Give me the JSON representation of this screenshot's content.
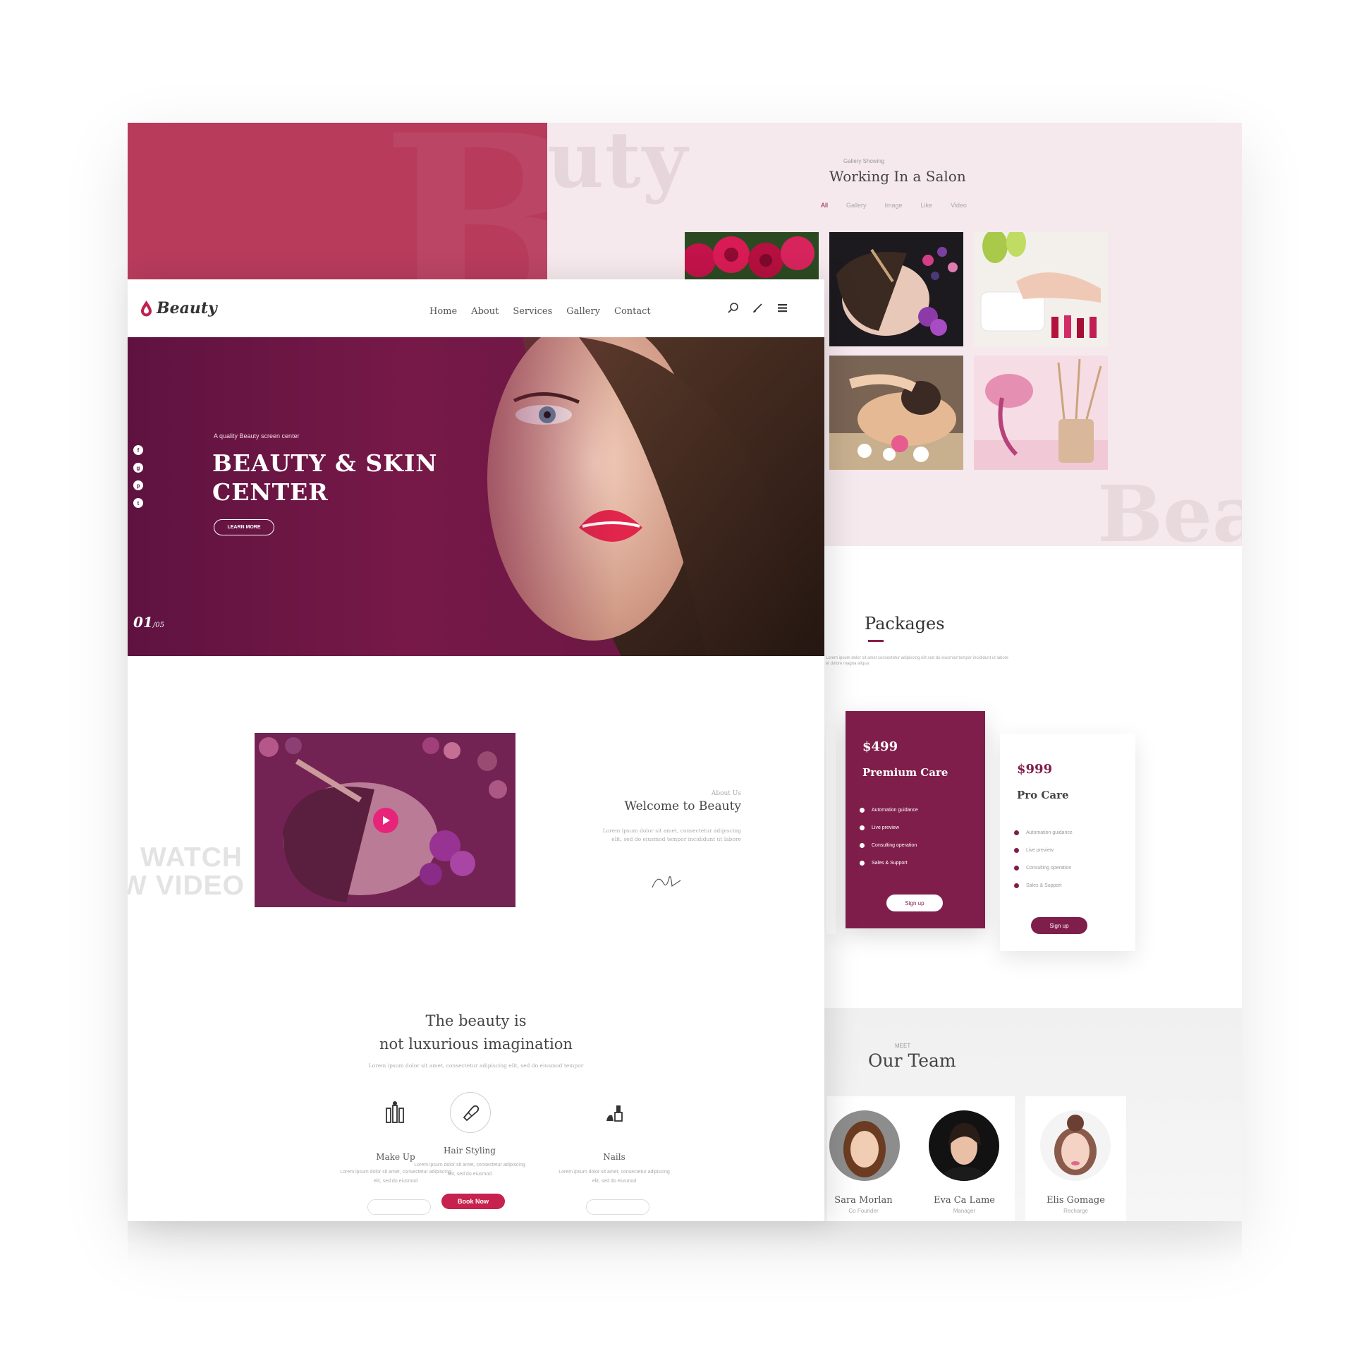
{
  "brand": {
    "name": "Beauty",
    "accent": "#801e4b",
    "crimson": "#b83b5c",
    "pink": "#e8237a"
  },
  "nav": {
    "items": [
      "Home",
      "About",
      "Services",
      "Gallery",
      "Contact"
    ],
    "icons": [
      "search-icon",
      "brush-icon",
      "menu-icon"
    ]
  },
  "hero": {
    "kicker": "A quality Beauty screen center",
    "title": "BEAUTY & SKIN CENTER",
    "button": "LEARN MORE",
    "counter_current": "01",
    "counter_total": "/05",
    "socials": [
      "f",
      "g",
      "p",
      "t"
    ]
  },
  "video": {
    "watch_line1": "WATCH",
    "watch_line2": "W VIDEO"
  },
  "about": {
    "kicker": "About Us",
    "title": "Welcome to Beauty",
    "text": "Lorem ipsum dolor sit amet, consectetur adipiscing elit, sed do eiusmod tempor incididunt ut labore"
  },
  "quote": {
    "line1": "The beauty is",
    "line2": "not luxurious imagination",
    "sub": "Lorem ipsum dolor sit amet, consectetur adipiscing elit, sed do eiusmod tempor"
  },
  "services": [
    {
      "name": "Make Up",
      "desc": "Lorem ipsum dolor sit amet, consectetur adipiscing elit, sed do eiusmod",
      "icon": "makeup-icon"
    },
    {
      "name": "Hair Styling",
      "desc": "Lorem ipsum dolor sit amet, consectetur adipiscing elit, sed do eiusmod",
      "icon": "hair-dryer-icon",
      "button": "Book Now"
    },
    {
      "name": "Nails",
      "desc": "Lorem ipsum dolor sit amet, consectetur adipiscing elit, sed do eiusmod",
      "icon": "nails-icon"
    }
  ],
  "gallery": {
    "kicker": "Gallery Showing",
    "title": "Working In a Salon",
    "filters": [
      "All",
      "Gallery",
      "Image",
      "Like",
      "Video"
    ],
    "active_filter": "All",
    "ghost_top": "uty",
    "ghost_bottom": "Bea"
  },
  "packages": {
    "title": "Packages",
    "desc": "Lorem ipsum dolor sit amet consectetur adipiscing elit sed do eiusmod tempor incididunt ut labore et dolore magna aliqua",
    "cards": [
      {
        "price": "$499",
        "name": "Premium Care",
        "features": [
          "Automation guidance",
          "Live preview",
          "Consulting operation",
          "Sales & Support"
        ],
        "button": "Sign up"
      },
      {
        "price": "$999",
        "name": "Pro Care",
        "features": [
          "Automation guidance",
          "Live preview",
          "Consulting operation",
          "Sales & Support"
        ],
        "button": "Sign up"
      }
    ]
  },
  "team": {
    "kicker": "MEET",
    "title": "Our Team",
    "members": [
      {
        "name": "Sara Morlan",
        "role": "Co Founder"
      },
      {
        "name": "Eva Ca Lame",
        "role": "Manager"
      },
      {
        "name": "Elis Gomage",
        "role": "Recharge"
      }
    ]
  }
}
